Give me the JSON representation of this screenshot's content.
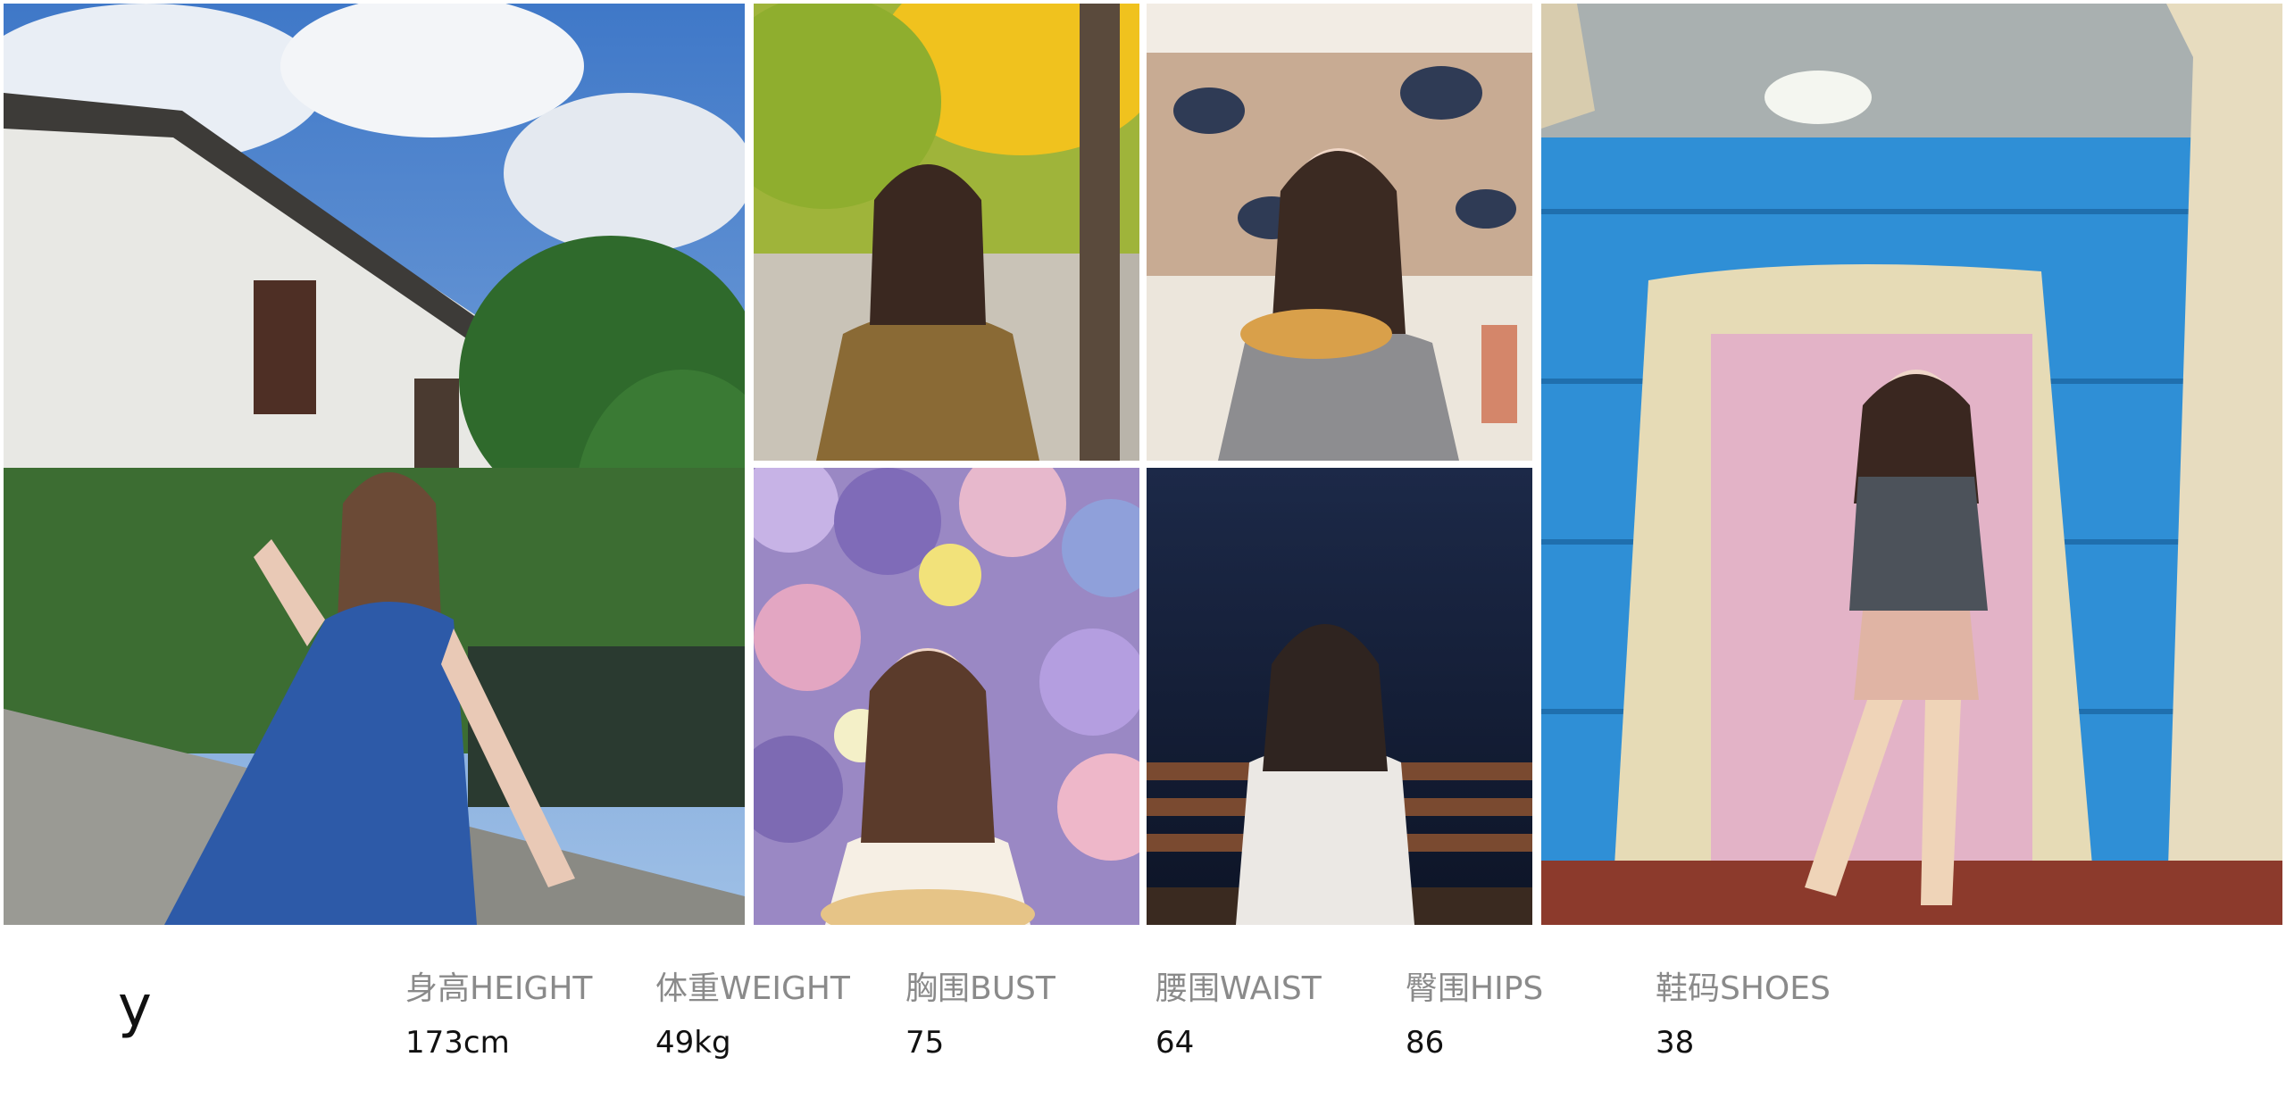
{
  "model": {
    "name": "y"
  },
  "stats": {
    "height": {
      "label": "身高HEIGHT",
      "value": "173cm"
    },
    "weight": {
      "label": "体重WEIGHT",
      "value": "49kg"
    },
    "bust": {
      "label": "胸围BUST",
      "value": "75"
    },
    "waist": {
      "label": "腰围WAIST",
      "value": "64"
    },
    "hips": {
      "label": "臀围HIPS",
      "value": "86"
    },
    "shoes": {
      "label": "鞋码SHOES",
      "value": "38"
    }
  }
}
